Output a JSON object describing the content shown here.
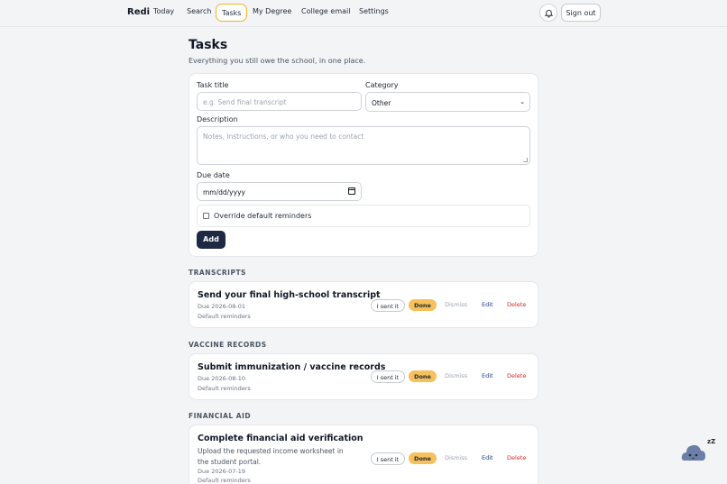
{
  "nav": {
    "brand": "Redi",
    "items": [
      "Today",
      "Search",
      "Tasks",
      "My Degree",
      "College email",
      "Settings"
    ],
    "active": "Tasks",
    "sign_out": "Sign out",
    "bell_icon": "bell-icon"
  },
  "page": {
    "title": "Tasks",
    "subtitle": "Everything you still owe the school, in one place."
  },
  "form": {
    "task_title_label": "Task title",
    "task_title_placeholder": "e.g. Send final transcript",
    "category_label": "Category",
    "category_value": "Other",
    "description_label": "Description",
    "description_placeholder": "Notes, instructions, or who you need to contact",
    "due_label": "Due date",
    "due_value": "mm/dd/yyyy",
    "override_label": "Override default reminders",
    "override_checked": false,
    "add_label": "Add"
  },
  "actions": {
    "sent": "I sent it",
    "done": "Done",
    "dismiss": "Dismiss",
    "edit": "Edit",
    "delete": "Delete"
  },
  "sections": [
    {
      "heading": "TRANSCRIPTS",
      "task": {
        "title": "Send your final high-school transcript",
        "due": "Due 2026-08-01",
        "reminders": "Default reminders",
        "description": ""
      }
    },
    {
      "heading": "VACCINE RECORDS",
      "task": {
        "title": "Submit immunization / vaccine records",
        "due": "Due 2026-08-10",
        "reminders": "Default reminders",
        "description": ""
      }
    },
    {
      "heading": "FINANCIAL AID",
      "task": {
        "title": "Complete financial aid verification",
        "due": "Due 2026-07-19",
        "reminders": "Default reminders",
        "description": "Upload the requested income worksheet in the student portal."
      }
    }
  ],
  "assistant": {
    "sleep_text": "zZ"
  },
  "colors": {
    "accent": "#f0b429",
    "done": "#f6c05a",
    "primary": "#1e2a44",
    "danger": "#dc2626"
  }
}
